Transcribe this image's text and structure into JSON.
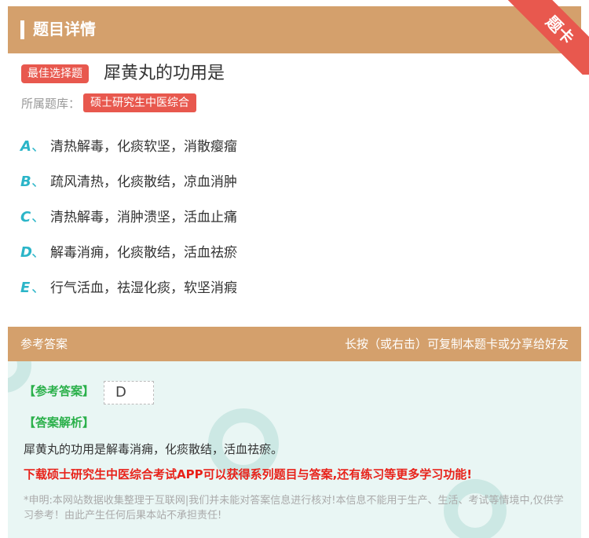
{
  "header": {
    "title": "题目详情",
    "corner_badge": "题卡"
  },
  "question": {
    "type_label": "最佳选择题",
    "title": "犀黄丸的功用是",
    "library_label": "所属题库：",
    "library_name": "硕士研究生中医综合",
    "options": [
      {
        "letter": "A",
        "sep": "、",
        "text": "清热解毒，化痰软坚，消散瘿瘤"
      },
      {
        "letter": "B",
        "sep": "、",
        "text": "疏风清热，化痰散结，凉血消肿"
      },
      {
        "letter": "C",
        "sep": "、",
        "text": "清热解毒，消肿溃坚，活血止痛"
      },
      {
        "letter": "D",
        "sep": "、",
        "text": "解毒消痈，化痰散结，活血祛瘀"
      },
      {
        "letter": "E",
        "sep": "、",
        "text": "行气活血，祛湿化痰，软坚消瘕"
      }
    ]
  },
  "answer": {
    "section_label": "参考答案",
    "hint": "长按（或右击）可复制本题卡或分享给好友",
    "ref_label": "【参考答案】",
    "ref_value": "D",
    "analysis_label": "【答案解析】",
    "analysis_text": "犀黄丸的功用是解毒消痈，化痰散结，活血祛瘀。",
    "promo": "下载硕士研究生中医综合考试APP可以获得系列题目与答案,还有练习等更多学习功能!",
    "disclaimer": "*申明:本网站数据收集整理于互联网|我们并未能对答案信息进行核对!本信息不能用于生产、生活、考试等情境中,仅供学习参考！由此产生任何后果本站不承担责任!"
  },
  "colors": {
    "brand": "#d4a06c",
    "accent_red": "#e8584e",
    "option_letter": "#2bb5c8",
    "answer_green": "#2ab04a",
    "promo_red": "#e8221a"
  }
}
